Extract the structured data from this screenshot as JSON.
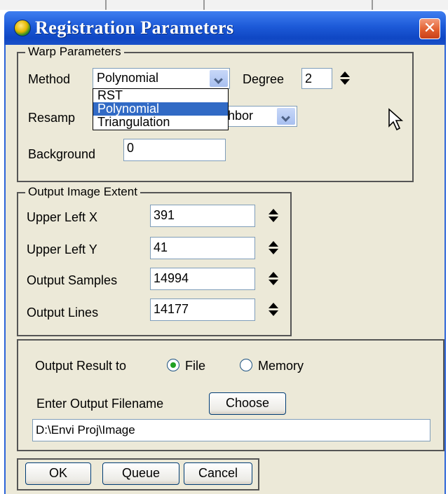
{
  "window": {
    "title": "Registration Parameters",
    "close_glyph": "✕"
  },
  "warp": {
    "legend": "Warp Parameters",
    "method_label": "Method",
    "method_value": "Polynomial",
    "degree_label": "Degree",
    "degree_value": "2",
    "resample_label_visible": "Resamp",
    "resample_value_visible": "hbor",
    "background_label": "Background",
    "background_value": "0",
    "method_options": [
      "RST",
      "Polynomial",
      "Triangulation"
    ]
  },
  "extent": {
    "legend": "Output Image Extent",
    "rows": [
      {
        "label": "Upper Left X",
        "value": "391"
      },
      {
        "label": "Upper Left Y",
        "value": "41"
      },
      {
        "label": "Output Samples",
        "value": "14994"
      },
      {
        "label": "Output Lines",
        "value": "14177"
      }
    ]
  },
  "output": {
    "result_label": "Output Result to",
    "file_label": "File",
    "memory_label": "Memory",
    "selected": "File",
    "filename_label": "Enter Output Filename",
    "choose_label": "Choose",
    "path": "D:\\Envi Proj\\Image"
  },
  "buttons": {
    "ok": "OK",
    "queue": "Queue",
    "cancel": "Cancel"
  },
  "icons": {
    "title": "envi-globe-icon",
    "close": "close-icon",
    "cursor": "mouse-pointer-icon"
  },
  "colors": {
    "titlebar": "#1d5ad8",
    "dialog_bg": "#ece9d8",
    "selection": "#316ac5",
    "close": "#e05a2a"
  }
}
